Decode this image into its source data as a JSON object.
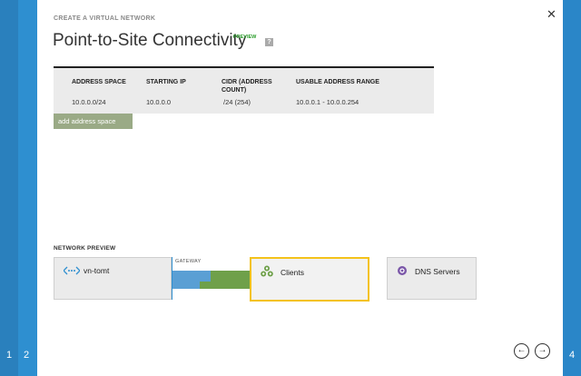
{
  "steps": {
    "step1": "1",
    "step2": "2",
    "step4": "4"
  },
  "header": {
    "eyebrow": "CREATE A VIRTUAL NETWORK",
    "title": "Point-to-Site Connectivity",
    "badge": "PREVIEW",
    "help_glyph": "?"
  },
  "table": {
    "columns": [
      "ADDRESS SPACE",
      "STARTING IP",
      "CIDR (ADDRESS COUNT)",
      "USABLE ADDRESS RANGE"
    ],
    "rows": [
      [
        "10.0.0.0/24",
        "10.0.0.0",
        "/24 (254)",
        "10.0.0.1 - 10.0.0.254"
      ]
    ]
  },
  "add_address_space_label": "add address space",
  "network_preview": {
    "label": "NETWORK PREVIEW",
    "vnet_label": "vn-tomt",
    "gateway_label": "GATEWAY",
    "clients_label": "Clients",
    "dns_label": "DNS Servers"
  },
  "colors": {
    "accent_blue": "#2e8fd0",
    "selected_border": "#f4c21a",
    "button_green": "#9aaa86"
  },
  "icons": {
    "close": "close-icon",
    "back": "arrow-left-icon",
    "next": "arrow-right-icon"
  }
}
